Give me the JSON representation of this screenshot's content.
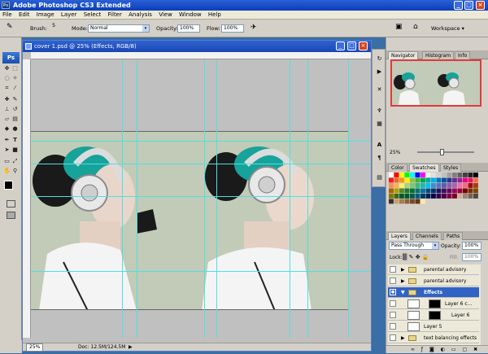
{
  "app": {
    "title": "Adobe Photoshop CS3 Extended",
    "logo": "Ps",
    "colors": {
      "titlebar": "#0a3fb8",
      "selection": "#3163c5",
      "guide": "#4fe0e0",
      "canvas_bg": "#c2cbb7"
    }
  },
  "window_buttons": {
    "minimize": "_",
    "maximize": "□",
    "close": "×"
  },
  "menu": [
    "File",
    "Edit",
    "Image",
    "Layer",
    "Select",
    "Filter",
    "Analysis",
    "View",
    "Window",
    "Help"
  ],
  "options_bar": {
    "brush_label": "Brush:",
    "brush_size": "5",
    "mode_label": "Mode:",
    "mode_value": "Normal",
    "opacity_label": "Opacity:",
    "opacity_value": "100%",
    "flow_label": "Flow:",
    "flow_value": "100%",
    "workspace_label": "Workspace ▾"
  },
  "document": {
    "title": "cover 1.psd @ 25% (Effects, RGB/8)",
    "zoom": "25%",
    "doc_size": "Doc: 12.5M/124.5M"
  },
  "navigator": {
    "tabs": [
      "Navigator",
      "Histogram",
      "Info"
    ],
    "zoom": "25%"
  },
  "swatches": {
    "tabs": [
      "Color",
      "Swatches",
      "Styles"
    ],
    "colors": [
      "#ffffff",
      "#ff0000",
      "#ffff00",
      "#00ff00",
      "#00ffff",
      "#0000ff",
      "#ff00ff",
      "#f0f0f0",
      "#e0e0e0",
      "#d0d0d0",
      "#c0c0c0",
      "#a0a0a0",
      "#808080",
      "#606060",
      "#404040",
      "#202020",
      "#000000",
      "#ed1c24",
      "#f26522",
      "#f7941d",
      "#fff200",
      "#8dc63f",
      "#39b54a",
      "#00a651",
      "#00a99d",
      "#00aeef",
      "#0072bc",
      "#0054a6",
      "#2e3192",
      "#662d91",
      "#92278f",
      "#ec008c",
      "#ed145b",
      "#f26c4f",
      "#f68e56",
      "#fbaf5d",
      "#fff568",
      "#acd373",
      "#7cc576",
      "#3cb878",
      "#1cbbb4",
      "#00bff3",
      "#448ccb",
      "#5674b9",
      "#605ca8",
      "#8560a8",
      "#a864a8",
      "#f06eaa",
      "#f26d7d",
      "#9e0b0f",
      "#a0410d",
      "#a36209",
      "#aba000",
      "#598527",
      "#197b30",
      "#007236",
      "#00746b",
      "#0076a3",
      "#004b80",
      "#003471",
      "#1b1464",
      "#440e62",
      "#630460",
      "#9e005d",
      "#9e0039",
      "#790000",
      "#7b2e00",
      "#7d4900",
      "#827b00",
      "#406618",
      "#005e20",
      "#005826",
      "#005952",
      "#005b7f",
      "#003663",
      "#002157",
      "#0d004c",
      "#32004b",
      "#4b0049",
      "#7b0046",
      "#7a0026",
      "#c7b299",
      "#998675",
      "#736357",
      "#534741",
      "#37302a",
      "#c69c6d",
      "#a67c52",
      "#8c6239",
      "#754c24",
      "#603913",
      "#ffe6b3"
    ]
  },
  "layers": {
    "tabs": [
      "Layers",
      "Channels",
      "Paths"
    ],
    "blend_mode": "Pass Through",
    "opacity_label": "Opacity:",
    "opacity_value": "100%",
    "lock_label": "Lock:",
    "fill_label": "Fill:",
    "fill_value": "100%",
    "items": [
      {
        "name": "parental advisory copy",
        "type": "folder",
        "selected": false
      },
      {
        "name": "parental advisory",
        "type": "folder",
        "selected": false
      },
      {
        "name": "Effects",
        "type": "folder",
        "selected": true
      },
      {
        "name": "Layer 6 c...",
        "type": "layer",
        "selected": false
      },
      {
        "name": "Layer 6",
        "type": "layer",
        "selected": false
      },
      {
        "name": "Layer 5",
        "type": "layer",
        "selected": false
      },
      {
        "name": "text balancing effects copy",
        "type": "folder",
        "selected": false
      }
    ]
  }
}
